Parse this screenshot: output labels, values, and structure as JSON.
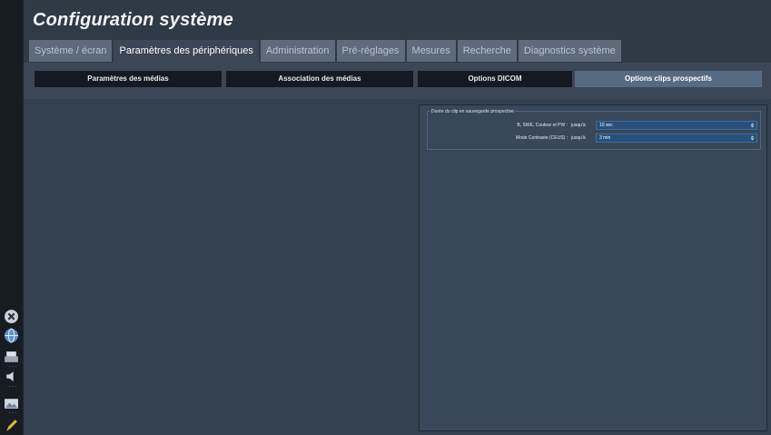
{
  "window": {
    "title": "Configuration système"
  },
  "tabs": [
    {
      "label": "Système / écran",
      "active": false
    },
    {
      "label": "Paramètres des périphériques",
      "active": true
    },
    {
      "label": "Administration",
      "active": false
    },
    {
      "label": "Pré-réglages",
      "active": false
    },
    {
      "label": "Mesures",
      "active": false
    },
    {
      "label": "Recherche",
      "active": false
    },
    {
      "label": "Diagnostics système",
      "active": false
    }
  ],
  "subtabs": [
    {
      "label": "Paramètres des médias",
      "active": false
    },
    {
      "label": "Association des médias",
      "active": false
    },
    {
      "label": "Options DICOM",
      "active": false
    },
    {
      "label": "Options clips prospectifs",
      "active": true
    }
  ],
  "clip_duration": {
    "title": "Durée du clip en sauvegarde prospective",
    "rows": [
      {
        "label": "B, SWE, Couleur et PW :",
        "prefix": "jusqu'à",
        "value": "10 sec"
      },
      {
        "label": "Mode Contraste (CEUS) :",
        "prefix": "jusqu'à",
        "value": "3 min"
      }
    ]
  },
  "sidebar": {
    "icons": [
      "close-circle-icon",
      "globe-icon",
      "print-icon",
      "volume-icon",
      "image-icon",
      "pencil-icon"
    ],
    "labels": [
      "- - -",
      "- - -",
      "- - -"
    ]
  },
  "colors": {
    "accent": "#566b82",
    "select_bg": "#27507a",
    "tab_inactive": "#5e6b7a",
    "background": "#2f3a47"
  }
}
